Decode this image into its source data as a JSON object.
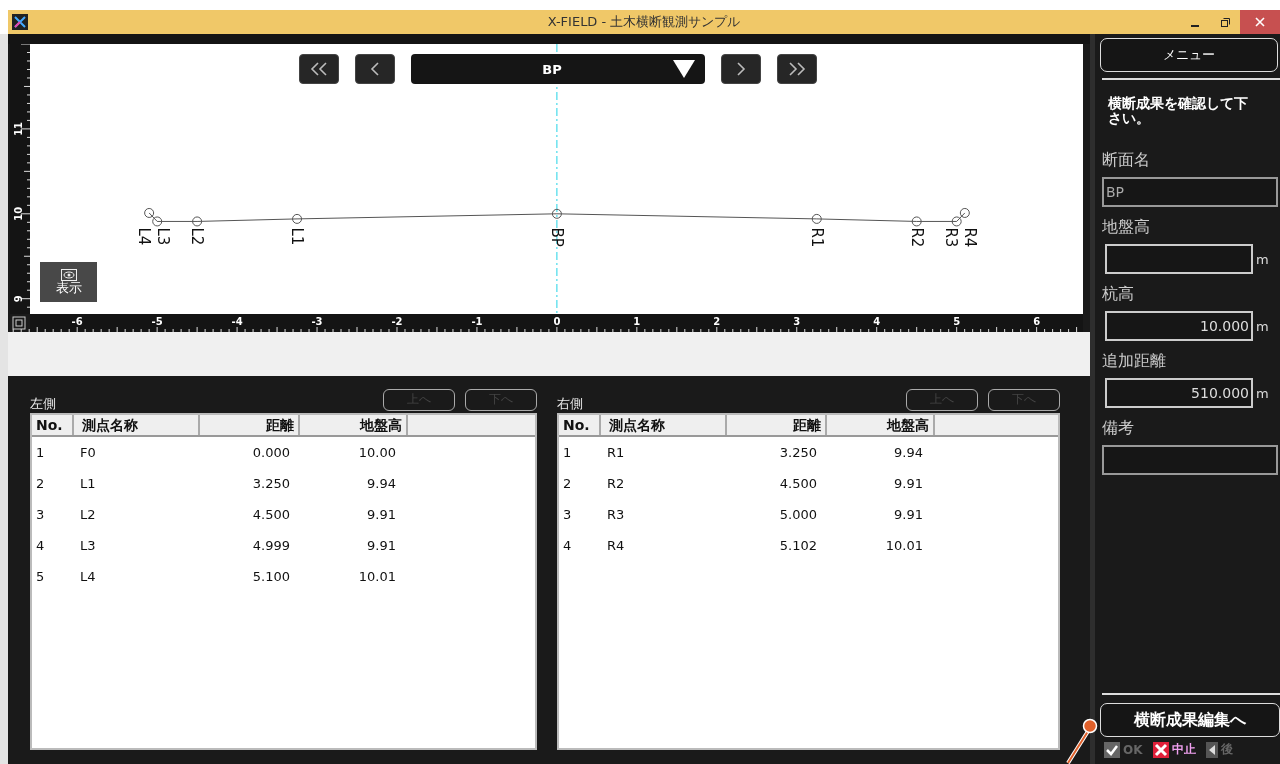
{
  "window": {
    "title": "X-FIELD - 土木横断観測サンプル"
  },
  "nav": {
    "section": "BP"
  },
  "chart_data": {
    "type": "line",
    "x": [
      -5.1,
      -4.999,
      -4.5,
      -3.25,
      0,
      3.25,
      4.5,
      5.0,
      5.102
    ],
    "xlim": [
      -6.59,
      6.58
    ],
    "ylim": [
      8.82,
      12
    ],
    "ref_lines": [
      {
        "axis": "x",
        "value": 0,
        "color": "#22d3e6"
      }
    ],
    "series": [
      {
        "color": "#555555",
        "marker": "circle",
        "values": [
          10.01,
          9.91,
          9.91,
          9.94,
          10.0,
          9.94,
          9.91,
          9.91,
          10.01
        ]
      }
    ],
    "xticks": [
      -6,
      -5,
      -4,
      -3,
      -2,
      -1,
      0,
      1,
      2,
      3,
      4,
      5,
      6
    ],
    "yticks": [
      9,
      10,
      11
    ],
    "annotations": [
      "L4",
      "L3",
      "L2",
      "L1",
      "BP",
      "R1",
      "R2",
      "R3",
      "R4"
    ]
  },
  "view_control": {
    "label": "表示"
  },
  "tables": [
    {
      "title": "左側",
      "buttons": [
        {
          "label": "上へ",
          "disabled": true
        },
        {
          "label": "下へ",
          "disabled": true
        }
      ],
      "columns": [
        "No.",
        "測点名称",
        "距離",
        "地盤高"
      ],
      "rows": [
        [
          "1",
          "F0",
          "0.000",
          "10.00"
        ],
        [
          "2",
          "L1",
          "3.250",
          "9.94"
        ],
        [
          "3",
          "L2",
          "4.500",
          "9.91"
        ],
        [
          "4",
          "L3",
          "4.999",
          "9.91"
        ],
        [
          "5",
          "L4",
          "5.100",
          "10.01"
        ]
      ]
    },
    {
      "title": "右側",
      "buttons": [
        {
          "label": "上へ",
          "disabled": true
        },
        {
          "label": "下へ",
          "disabled": true
        }
      ],
      "columns": [
        "No.",
        "測点名称",
        "距離",
        "地盤高"
      ],
      "rows": [
        [
          "1",
          "R1",
          "3.250",
          "9.94"
        ],
        [
          "2",
          "R2",
          "4.500",
          "9.91"
        ],
        [
          "3",
          "R3",
          "5.000",
          "9.91"
        ],
        [
          "4",
          "R4",
          "5.102",
          "10.01"
        ]
      ]
    }
  ],
  "sidebar": {
    "menu_button": "メニュー",
    "instruction": "横断成果を確認して下さい。",
    "fields": [
      {
        "label": "断面名",
        "kind": "text",
        "value": "BP"
      },
      {
        "label": "地盤高",
        "kind": "number",
        "unit": "m"
      },
      {
        "label": "杭高",
        "kind": "number",
        "value": "10.000",
        "unit": "m"
      },
      {
        "label": "追加距離",
        "kind": "number",
        "value": "510.000",
        "unit": "m"
      },
      {
        "label": "備考",
        "kind": "text"
      }
    ],
    "action_button": "横断成果編集へ",
    "footer": [
      {
        "label": "OK",
        "kind": "ok",
        "disabled": true
      },
      {
        "label": "中止",
        "kind": "cancel",
        "disabled": false
      },
      {
        "label": "後",
        "kind": "back",
        "disabled": true
      }
    ]
  }
}
